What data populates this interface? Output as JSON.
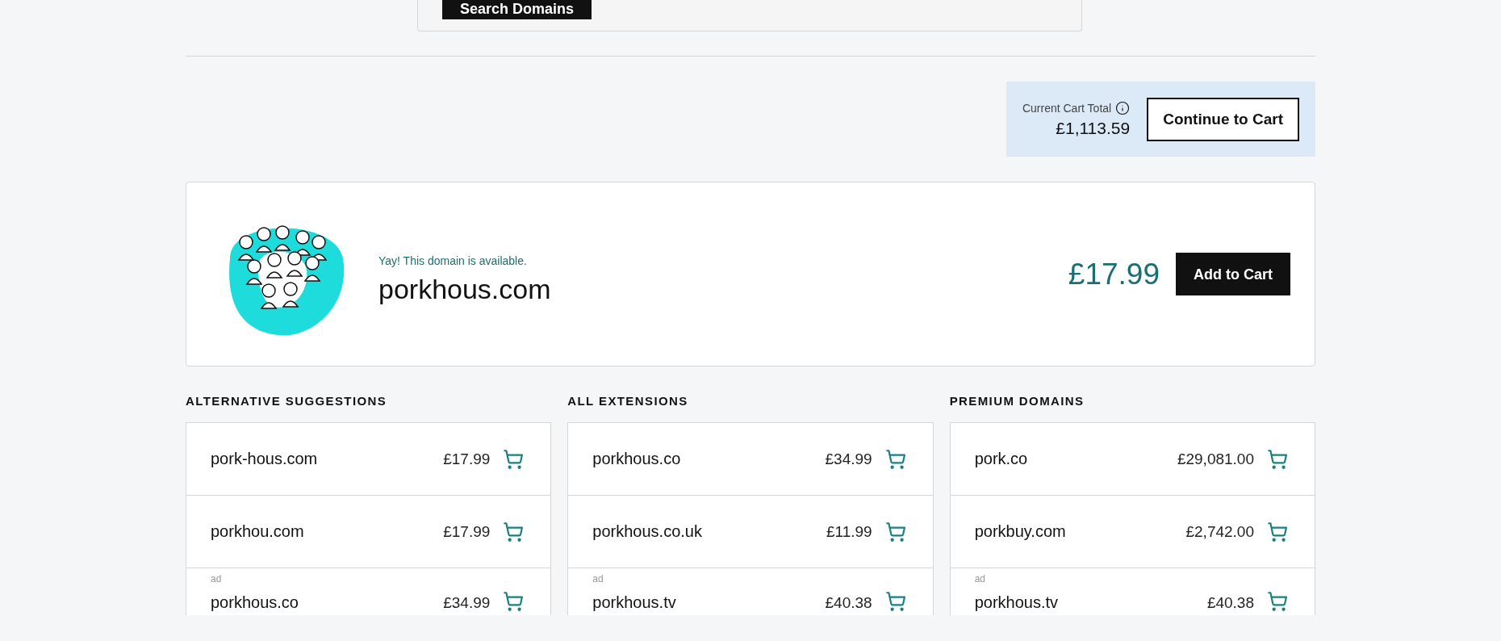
{
  "search": {
    "button": "Search Domains"
  },
  "cart": {
    "label": "Current Cart Total",
    "total": "£1,113.59",
    "button": "Continue to Cart"
  },
  "result": {
    "message": "Yay! This domain is available.",
    "domain": "porkhous.com",
    "price": "£17.99",
    "button": "Add to Cart"
  },
  "sections": [
    {
      "title": "ALTERNATIVE SUGGESTIONS",
      "rows": [
        {
          "domain": "pork-hous.com",
          "price": "£17.99"
        },
        {
          "domain": "porkhou.com",
          "price": "£17.99"
        },
        {
          "tag": "ad",
          "domain": "porkhous.co",
          "price": "£34.99"
        }
      ]
    },
    {
      "title": "ALL EXTENSIONS",
      "rows": [
        {
          "domain": "porkhous.co",
          "price": "£34.99"
        },
        {
          "domain": "porkhous.co.uk",
          "price": "£11.99"
        },
        {
          "tag": "ad",
          "domain": "porkhous.tv",
          "price": "£40.38"
        }
      ]
    },
    {
      "title": "PREMIUM DOMAINS",
      "rows": [
        {
          "domain": "pork.co",
          "price": "£29,081.00"
        },
        {
          "domain": "porkbuy.com",
          "price": "£2,742.00"
        },
        {
          "tag": "ad",
          "domain": "porkhous.tv",
          "price": "£40.38"
        }
      ]
    }
  ]
}
